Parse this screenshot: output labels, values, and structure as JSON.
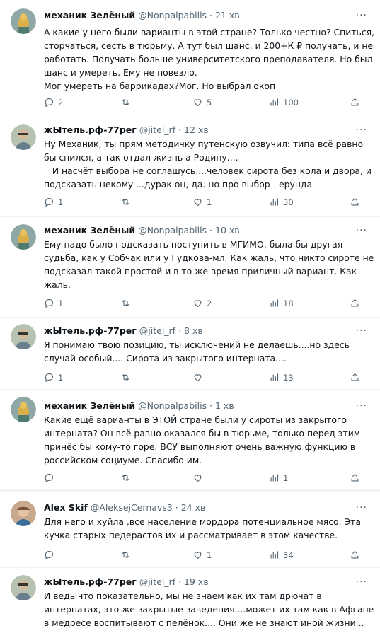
{
  "tweets": [
    {
      "name": "механик Зелёный",
      "handle": "@Nonpalpabilis",
      "time": "21 хв",
      "text": "А какие у него были варианты в этой стране? Только честно? Спиться, сторчаться, сесть в тюрьму. А тут был шанс, и 200+К ₽ получать, и не работать. Получать больше университетского преподавателя. Но был шанс и умереть. Ему не повезло.\nМог умереть на баррикадах?Мог. Но выбрал окоп",
      "replies": "2",
      "retweets": "",
      "likes": "5",
      "views": "100"
    },
    {
      "name": "жЫтель.рф-77рег",
      "handle": "@jitel_rf",
      "time": "12 хв",
      "text": "Ну Механик, ты прям методичку путенскую озвучил: типа всё равно бы спился, а так отдал жизнь а Родину....\n   И насчёт выбора не соглашусь....человек сирота без кола и двора, и подсказать некому ...дурак он, да. но про выбор - ерунда",
      "replies": "1",
      "retweets": "",
      "likes": "1",
      "views": "30"
    },
    {
      "name": "механик Зелёный",
      "handle": "@Nonpalpabilis",
      "time": "10 хв",
      "text": "Ему надо было подсказать поступить в МГИМО, была бы другая судьба, как у Собчак или у Гудкова-мл. Как жаль, что никто сироте не подсказал такой простой и в то же время приличный вариант. Как жаль.",
      "replies": "1",
      "retweets": "",
      "likes": "2",
      "views": "18"
    },
    {
      "name": "жЫтель.рф-77рег",
      "handle": "@jitel_rf",
      "time": "8 хв",
      "text": "Я понимаю твою позицию, ты исключений не делаешь....но здесь случай особый.... Сирота из закрытого интерната....",
      "replies": "1",
      "retweets": "",
      "likes": "",
      "views": "13"
    },
    {
      "name": "механик Зелёный",
      "handle": "@Nonpalpabilis",
      "time": "1 хв",
      "text": "Какие ещё варианты в ЭТОЙ стране были у сироты из закрытого интерната? Он всё равно оказался бы в тюрьме, только перед этим принёс бы кому-то горе. ВСУ выполняют очень важную функцию в российском социуме. Спасибо им.",
      "replies": "",
      "retweets": "",
      "likes": "",
      "views": "1"
    },
    {
      "name": "Alex Skif",
      "handle": "@AleksejCernavs3",
      "time": "24 хв",
      "text": "Для него и хуйла ,все население мордора потенциальное мясо. Эта кучка старых педерастов их и рассматривает в этом качестве.",
      "replies": "",
      "retweets": "",
      "likes": "1",
      "views": "34"
    },
    {
      "name": "жЫтель.рф-77рег",
      "handle": "@jitel_rf",
      "time": "19 хв",
      "text": "И ведь что показательно, мы не знаем как их там дрючат в интернатах, это же закрытые заведения....может их там как в Афгане в медресе воспитывают с пелёнок.... Они же не знают иной жизни...",
      "replies": "",
      "retweets": "",
      "likes": "",
      "views": ""
    }
  ]
}
